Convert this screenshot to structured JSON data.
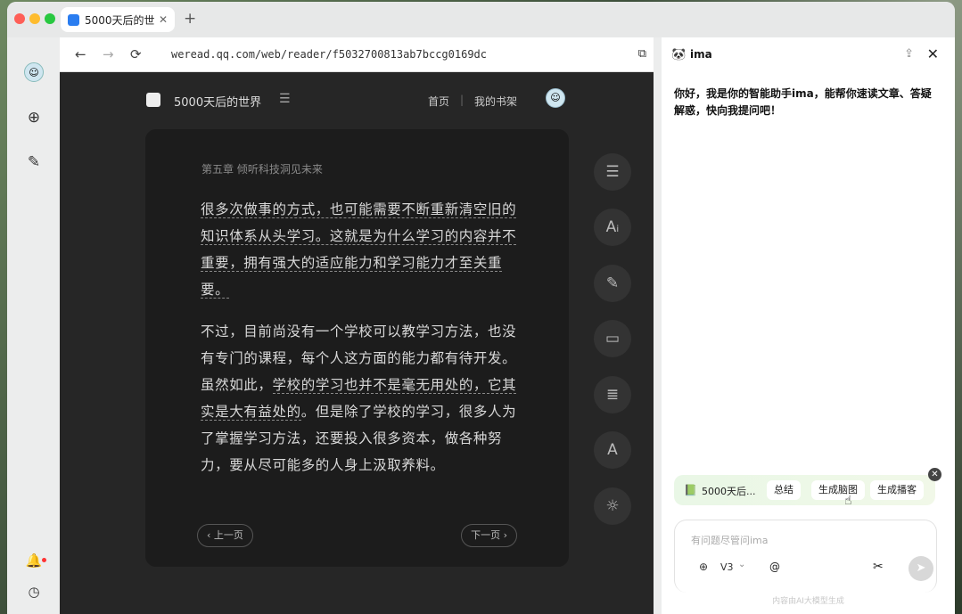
{
  "browser_tab": {
    "title": "5000天后的世",
    "close": "✕",
    "new_tab": "+"
  },
  "urlbar": {
    "url": "weread.qq.com/web/reader/f5032700813ab7bccg0169dc"
  },
  "reader": {
    "book_title": "5000天后的世界",
    "nav_home": "首页",
    "nav_sep": "|",
    "nav_shelf": "我的书架",
    "chapter": "第五章  倾听科技洞见未来",
    "para1_underlined": "很多次做事的方式，也可能需要不断重新清空旧的知识体系从头学习。这就是为什么学习的内容并不重要，拥有强大的适应能力和学习能力才至关重要。",
    "para2_a": "不过，目前尚没有一个学校可以教学习方法，也没有专门的课程，每个人这方面的能力都有待开发。虽然如此，",
    "para2_b": "学校的学习也并不是毫无用处的，它其实是大有益处的",
    "para2_c": "。但是除了学校的学习，很多人为了掌握学习方法，还要投入很多资本，做各种努力，要从尽可能多的人身上汲取养料。",
    "prev_page": "上一页",
    "next_page": "下一页"
  },
  "ima": {
    "name": "ima",
    "greeting": "你好，我是你的智能助手ima，能帮你速读文章、答疑解惑，快向我提问吧！",
    "context_book": "5000天后...",
    "chips": [
      "总结",
      "生成脑图",
      "生成播客"
    ],
    "dismiss": "✕",
    "input_placeholder": "有问题尽管问ima",
    "model": "V3",
    "at": "@",
    "footnote": "内容由AI大模型生成"
  },
  "icons": {
    "back": "←",
    "forward": "→",
    "reload": "⟳",
    "extension": "⧉",
    "toc": "☰",
    "font_size": "Aᵢ",
    "note": "✎",
    "comment": "▭",
    "notes_list": "≣",
    "typeface": "A",
    "theme": "☼",
    "share": "⇪",
    "close": "✕",
    "globe": "⊕",
    "chevron": "⌄",
    "scissors": "✂",
    "send": "➤",
    "sidebar_ai": "⊕",
    "sidebar_edit": "✎",
    "bell": "🔔",
    "clock": "◷",
    "cursor": "☝"
  }
}
